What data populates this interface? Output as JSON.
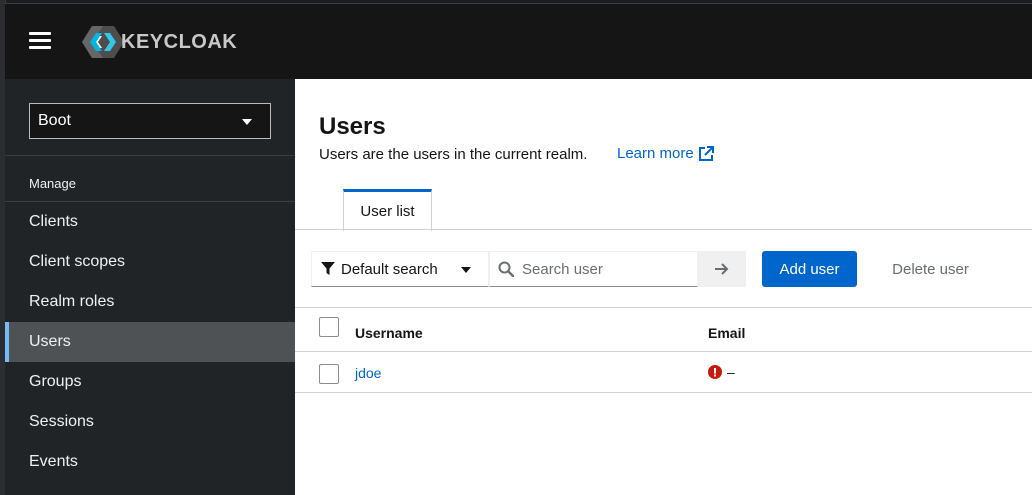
{
  "app": {
    "brand": "KEYCLOAK"
  },
  "colors": {
    "accent": "#0066cc",
    "masthead": "#151515",
    "sidebar": "#212427",
    "active_nav": "#4f5255",
    "error": "#c9190b"
  },
  "sidebar": {
    "realm": "Boot",
    "section": "Manage",
    "items": [
      {
        "label": "Clients"
      },
      {
        "label": "Client scopes"
      },
      {
        "label": "Realm roles"
      },
      {
        "label": "Users",
        "active": true
      },
      {
        "label": "Groups"
      },
      {
        "label": "Sessions"
      },
      {
        "label": "Events"
      }
    ]
  },
  "page": {
    "title": "Users",
    "description": "Users are the users in the current realm.",
    "learn_more": "Learn more"
  },
  "tabs": [
    {
      "label": "User list",
      "active": true
    }
  ],
  "toolbar": {
    "filter_label": "Default search",
    "search_placeholder": "Search user",
    "add_user": "Add user",
    "delete_user": "Delete user"
  },
  "table": {
    "columns": [
      "Username",
      "Email"
    ],
    "rows": [
      {
        "username": "jdoe",
        "email": "–",
        "email_icon": "exclamation-circle-icon"
      }
    ]
  }
}
